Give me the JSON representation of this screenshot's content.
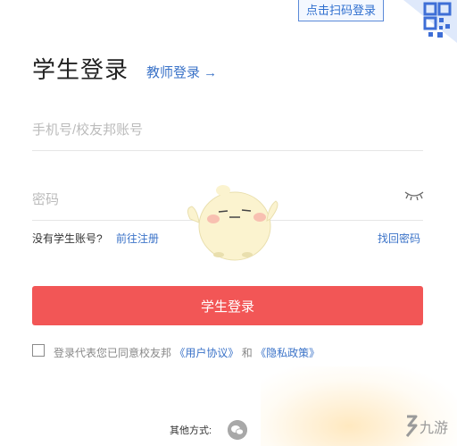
{
  "qr_login": {
    "tip": "点击扫码登录",
    "icon": "qr-code-icon"
  },
  "header": {
    "title": "学生登录",
    "teacher_link": "教师登录 →"
  },
  "form": {
    "phone_placeholder": "手机号/校友邦账号",
    "password_placeholder": "密码",
    "eye_icon": "eye-closed-icon",
    "no_account": "没有学生账号?",
    "register": "前往注册",
    "forgot": "找回密码",
    "submit": "学生登录"
  },
  "agreement": {
    "prefix": "登录代表您已同意校友邦",
    "user_agreement": "《用户协议》",
    "and": "和",
    "privacy": "《隐私政策》"
  },
  "other_methods": {
    "label": "其他方式:",
    "icon": "wechat-icon"
  },
  "watermark": {
    "text": "九游"
  },
  "colors": {
    "accent": "#3b73c8",
    "button": "#f25656"
  }
}
